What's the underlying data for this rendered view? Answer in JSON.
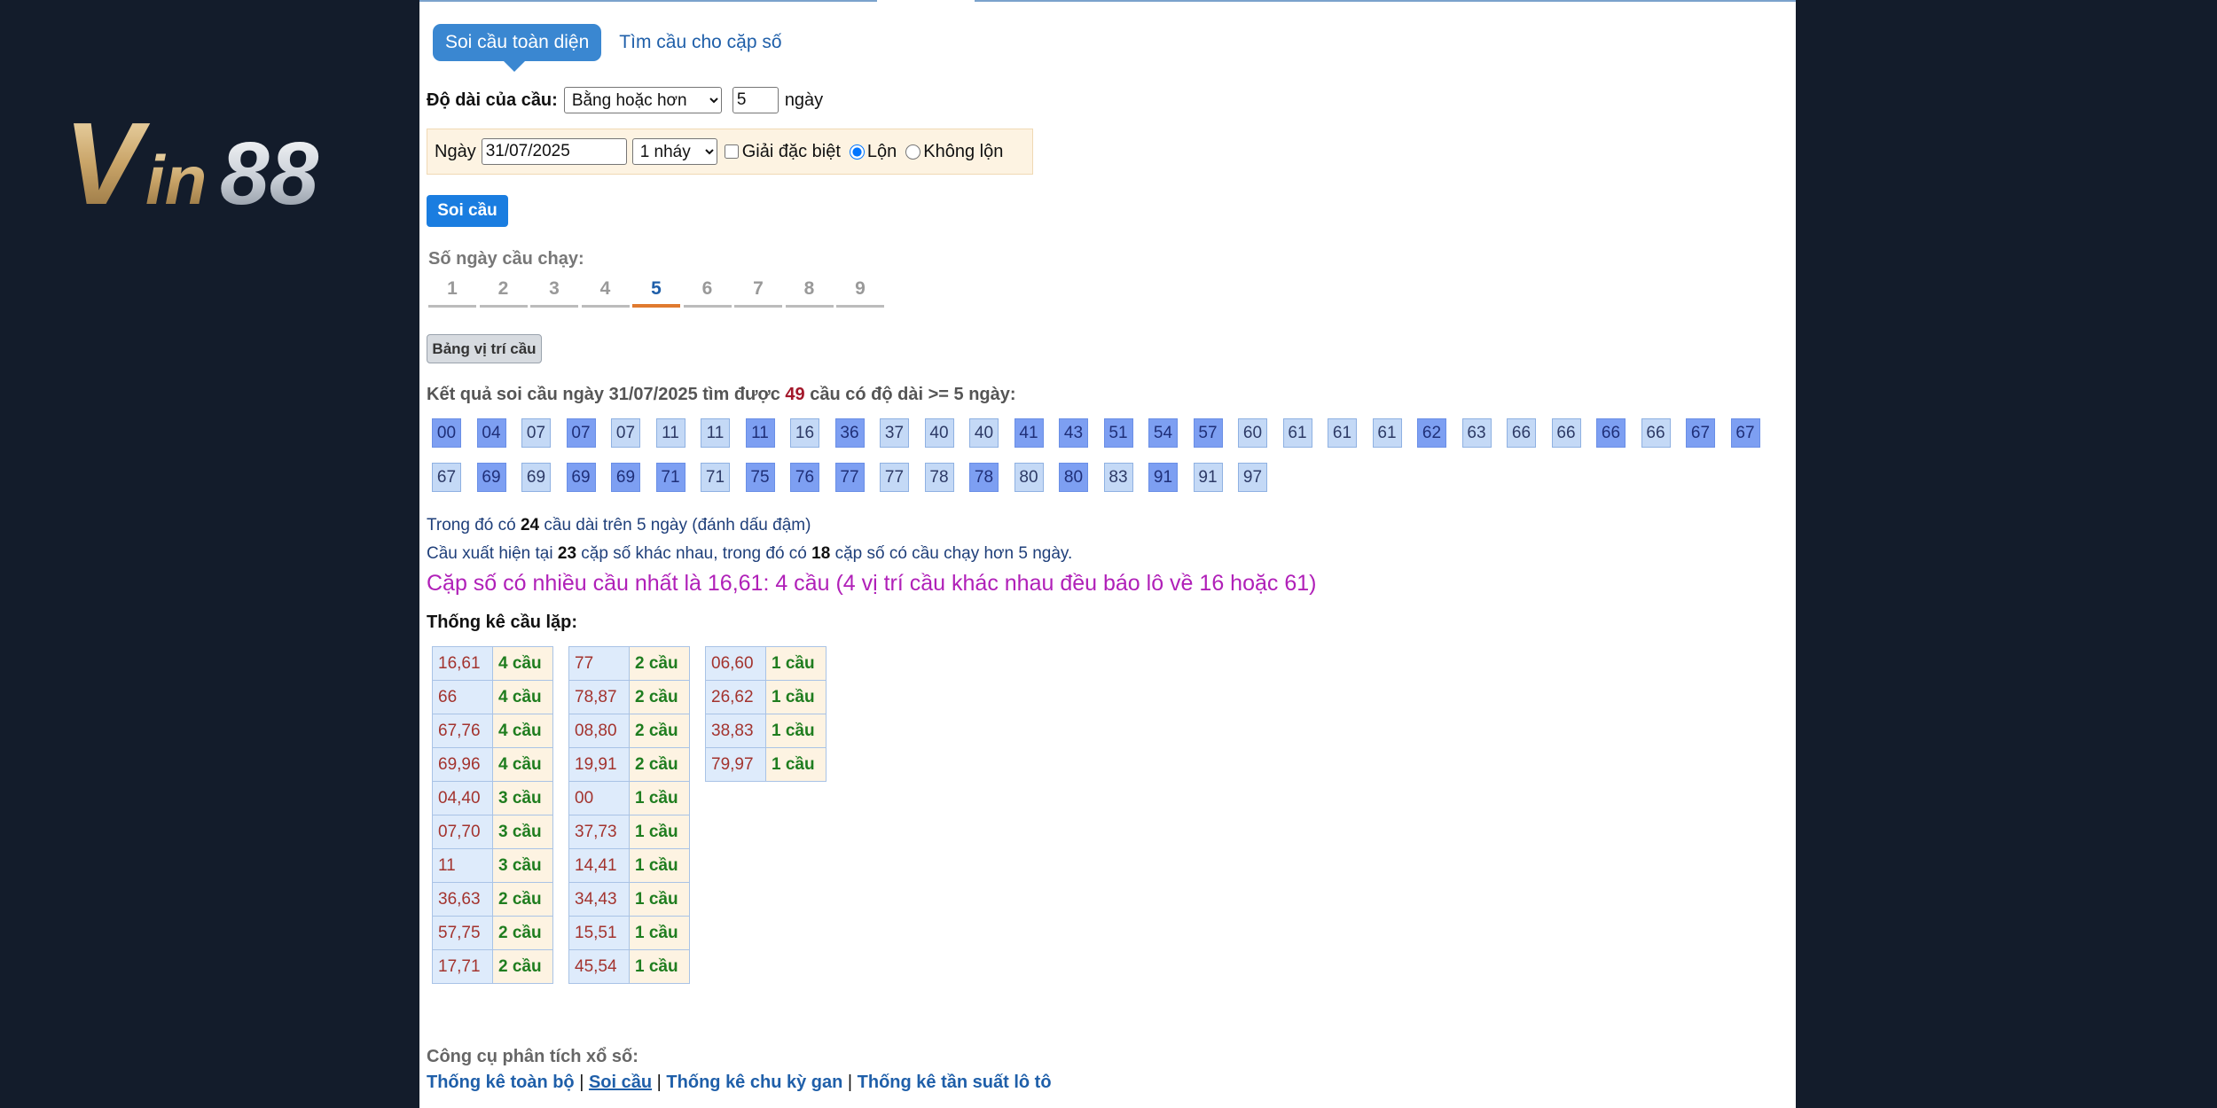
{
  "logo": {
    "text": "Vin88"
  },
  "tabs": [
    {
      "label": "Soi cầu toàn diện",
      "active": true
    },
    {
      "label": "Tìm cầu cho cặp số",
      "active": false
    }
  ],
  "length_row": {
    "label": "Độ dài của cầu:",
    "select_value": "Bằng hoặc hơn",
    "input_value": "5",
    "unit": "ngày"
  },
  "filter": {
    "date_label": "Ngày",
    "date_value": "31/07/2025",
    "nhay_value": "1 nháy",
    "special_label": "Giải đặc biệt",
    "special_checked": false,
    "radio_lon": "Lộn",
    "radio_khong_lon": "Không lộn",
    "selected_radio": "Lộn"
  },
  "submit_label": "Soi cầu",
  "days_label": "Số ngày cầu chạy:",
  "days": [
    "1",
    "2",
    "3",
    "4",
    "5",
    "6",
    "7",
    "8",
    "9"
  ],
  "active_day": "5",
  "table_button_label": "Bảng vị trí cầu",
  "result": {
    "prefix": "Kết quả soi cầu ngày 31/07/2025 tìm được",
    "count": "49",
    "suffix": "cầu có độ dài >= 5 ngày:"
  },
  "chips": [
    {
      "n": "00",
      "b": true
    },
    {
      "n": "04",
      "b": true
    },
    {
      "n": "07",
      "b": false
    },
    {
      "n": "07",
      "b": true
    },
    {
      "n": "07",
      "b": false
    },
    {
      "n": "11",
      "b": false
    },
    {
      "n": "11",
      "b": false
    },
    {
      "n": "11",
      "b": true
    },
    {
      "n": "16",
      "b": false
    },
    {
      "n": "36",
      "b": true
    },
    {
      "n": "37",
      "b": false
    },
    {
      "n": "40",
      "b": false
    },
    {
      "n": "40",
      "b": false
    },
    {
      "n": "41",
      "b": true
    },
    {
      "n": "43",
      "b": true
    },
    {
      "n": "51",
      "b": true
    },
    {
      "n": "54",
      "b": true
    },
    {
      "n": "57",
      "b": true
    },
    {
      "n": "60",
      "b": false
    },
    {
      "n": "61",
      "b": false
    },
    {
      "n": "61",
      "b": false
    },
    {
      "n": "61",
      "b": false
    },
    {
      "n": "62",
      "b": true
    },
    {
      "n": "63",
      "b": false
    },
    {
      "n": "66",
      "b": false
    },
    {
      "n": "66",
      "b": false
    },
    {
      "n": "66",
      "b": true
    },
    {
      "n": "66",
      "b": false
    },
    {
      "n": "67",
      "b": true
    },
    {
      "n": "67",
      "b": true
    },
    {
      "n": "67",
      "b": false
    },
    {
      "n": "69",
      "b": true
    },
    {
      "n": "69",
      "b": false
    },
    {
      "n": "69",
      "b": true
    },
    {
      "n": "69",
      "b": true
    },
    {
      "n": "71",
      "b": true
    },
    {
      "n": "71",
      "b": false
    },
    {
      "n": "75",
      "b": true
    },
    {
      "n": "76",
      "b": true
    },
    {
      "n": "77",
      "b": true
    },
    {
      "n": "77",
      "b": false
    },
    {
      "n": "78",
      "b": false
    },
    {
      "n": "78",
      "b": true
    },
    {
      "n": "80",
      "b": false
    },
    {
      "n": "80",
      "b": true
    },
    {
      "n": "83",
      "b": false
    },
    {
      "n": "91",
      "b": true
    },
    {
      "n": "91",
      "b": false
    },
    {
      "n": "97",
      "b": false
    }
  ],
  "info1": {
    "a": "Trong đó có",
    "n": "24",
    "b": "cầu dài trên 5 ngày (đánh dấu đậm)"
  },
  "info2": {
    "a": "Cầu xuất hiện tại",
    "n1": "23",
    "b": "cặp số khác nhau, trong đó có",
    "n2": "18",
    "c": "cặp số có cầu chạy hơn 5 ngày."
  },
  "best": "Cặp số có nhiều cầu nhất là 16,61: 4 cầu (4 vị trí cầu khác nhau đều báo lô về 16 hoặc 61)",
  "stat_title": "Thống kê cầu lặp:",
  "stats": [
    [
      [
        "16,61",
        "4 cầu"
      ],
      [
        "66",
        "4 cầu"
      ],
      [
        "67,76",
        "4 cầu"
      ],
      [
        "69,96",
        "4 cầu"
      ],
      [
        "04,40",
        "3 cầu"
      ],
      [
        "07,70",
        "3 cầu"
      ],
      [
        "11",
        "3 cầu"
      ],
      [
        "36,63",
        "2 cầu"
      ],
      [
        "57,75",
        "2 cầu"
      ],
      [
        "17,71",
        "2 cầu"
      ]
    ],
    [
      [
        "77",
        "2 cầu"
      ],
      [
        "78,87",
        "2 cầu"
      ],
      [
        "08,80",
        "2 cầu"
      ],
      [
        "19,91",
        "2 cầu"
      ],
      [
        "00",
        "1 cầu"
      ],
      [
        "37,73",
        "1 cầu"
      ],
      [
        "14,41",
        "1 cầu"
      ],
      [
        "34,43",
        "1 cầu"
      ],
      [
        "15,51",
        "1 cầu"
      ],
      [
        "45,54",
        "1 cầu"
      ]
    ],
    [
      [
        "06,60",
        "1 cầu"
      ],
      [
        "26,62",
        "1 cầu"
      ],
      [
        "38,83",
        "1 cầu"
      ],
      [
        "79,97",
        "1 cầu"
      ]
    ]
  ],
  "tools_label": "Công cụ phân tích xổ số:",
  "tools": [
    "Thống kê toàn bộ",
    "Soi cầu",
    "Thống kê chu kỳ gan",
    "Thống kê tần suất lô tô"
  ]
}
